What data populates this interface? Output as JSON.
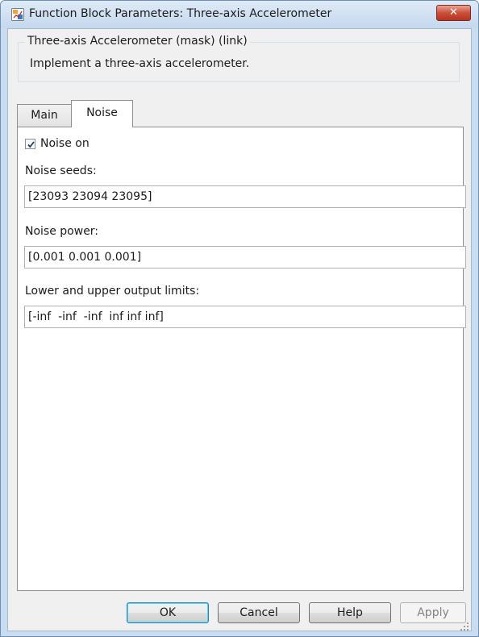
{
  "window": {
    "title": "Function Block Parameters: Three-axis Accelerometer",
    "close_label": "✕"
  },
  "mask": {
    "group_title": "Three-axis Accelerometer (mask) (link)",
    "description": "Implement a three-axis accelerometer."
  },
  "tabs": [
    {
      "label": "Main",
      "active": false
    },
    {
      "label": "Noise",
      "active": true
    }
  ],
  "noise": {
    "noise_on": {
      "label": "Noise on",
      "checked": true
    },
    "noise_seeds": {
      "label": "Noise seeds:",
      "value": "[23093 23094 23095]"
    },
    "noise_power": {
      "label": "Noise power:",
      "value": "[0.001 0.001 0.001]"
    },
    "output_limits": {
      "label": "Lower and upper output limits:",
      "value": "[-inf  -inf  -inf  inf inf inf]"
    }
  },
  "buttons": {
    "ok": "OK",
    "cancel": "Cancel",
    "help": "Help",
    "apply": "Apply",
    "apply_enabled": false
  },
  "icons": {
    "app": "simulink-block-icon",
    "close": "close-icon",
    "checkbox": "checkmark-icon",
    "resize": "resize-grip-icon"
  },
  "colors": {
    "title_bar": "#c9dcf0",
    "close_button": "#c9503b",
    "dialog_bg": "#f0f0f0",
    "panel_bg": "#ffffff",
    "default_button_border": "#3c7fb1"
  }
}
